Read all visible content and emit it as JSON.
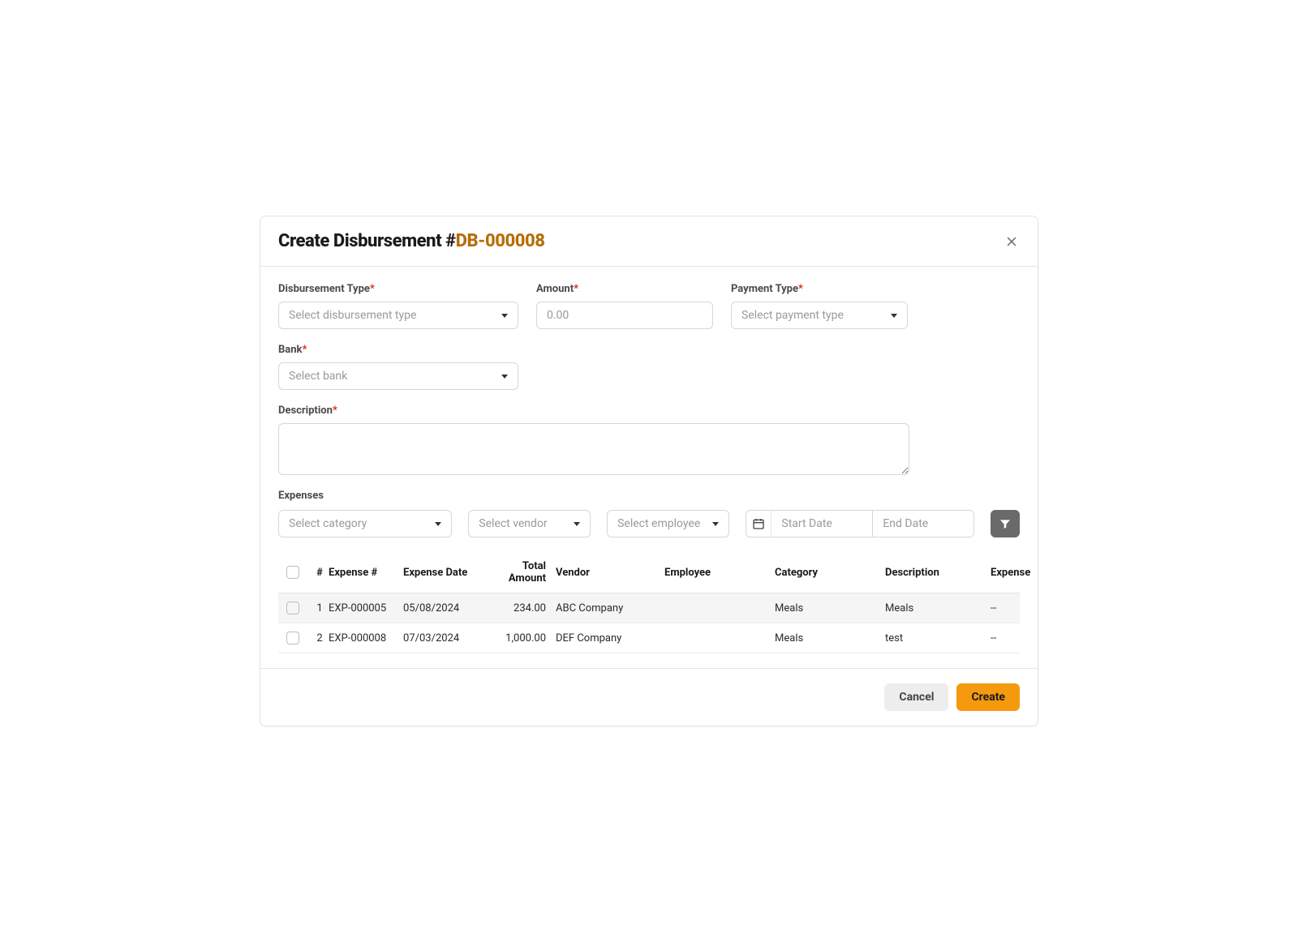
{
  "header": {
    "title_prefix": "Create Disbursement #",
    "number": "DB-000008"
  },
  "form": {
    "disbursement_type": {
      "label": "Disbursement Type",
      "placeholder": "Select disbursement type"
    },
    "amount": {
      "label": "Amount",
      "placeholder": "0.00"
    },
    "payment_type": {
      "label": "Payment Type",
      "placeholder": "Select payment type"
    },
    "bank": {
      "label": "Bank",
      "placeholder": "Select bank"
    },
    "description": {
      "label": "Description"
    }
  },
  "expenses": {
    "section_label": "Expenses",
    "filters": {
      "category_placeholder": "Select category",
      "vendor_placeholder": "Select vendor",
      "employee_placeholder": "Select employee",
      "start_date_placeholder": "Start Date",
      "end_date_placeholder": "End Date"
    },
    "columns": {
      "num": "#",
      "expense_num": "Expense #",
      "expense_date": "Expense Date",
      "total_amount": "Total Amount",
      "vendor": "Vendor",
      "employee": "Employee",
      "category": "Category",
      "description": "Description",
      "expense": "Expense"
    },
    "rows": [
      {
        "num": "1",
        "expense_num": "EXP-000005",
        "expense_date": "05/08/2024",
        "total_amount": "234.00",
        "vendor": "ABC Company",
        "employee": "",
        "category": "Meals",
        "description": "Meals",
        "expense": "--"
      },
      {
        "num": "2",
        "expense_num": "EXP-000008",
        "expense_date": "07/03/2024",
        "total_amount": "1,000.00",
        "vendor": "DEF Company",
        "employee": "",
        "category": "Meals",
        "description": "test",
        "expense": "--"
      }
    ]
  },
  "footer": {
    "cancel": "Cancel",
    "create": "Create"
  }
}
